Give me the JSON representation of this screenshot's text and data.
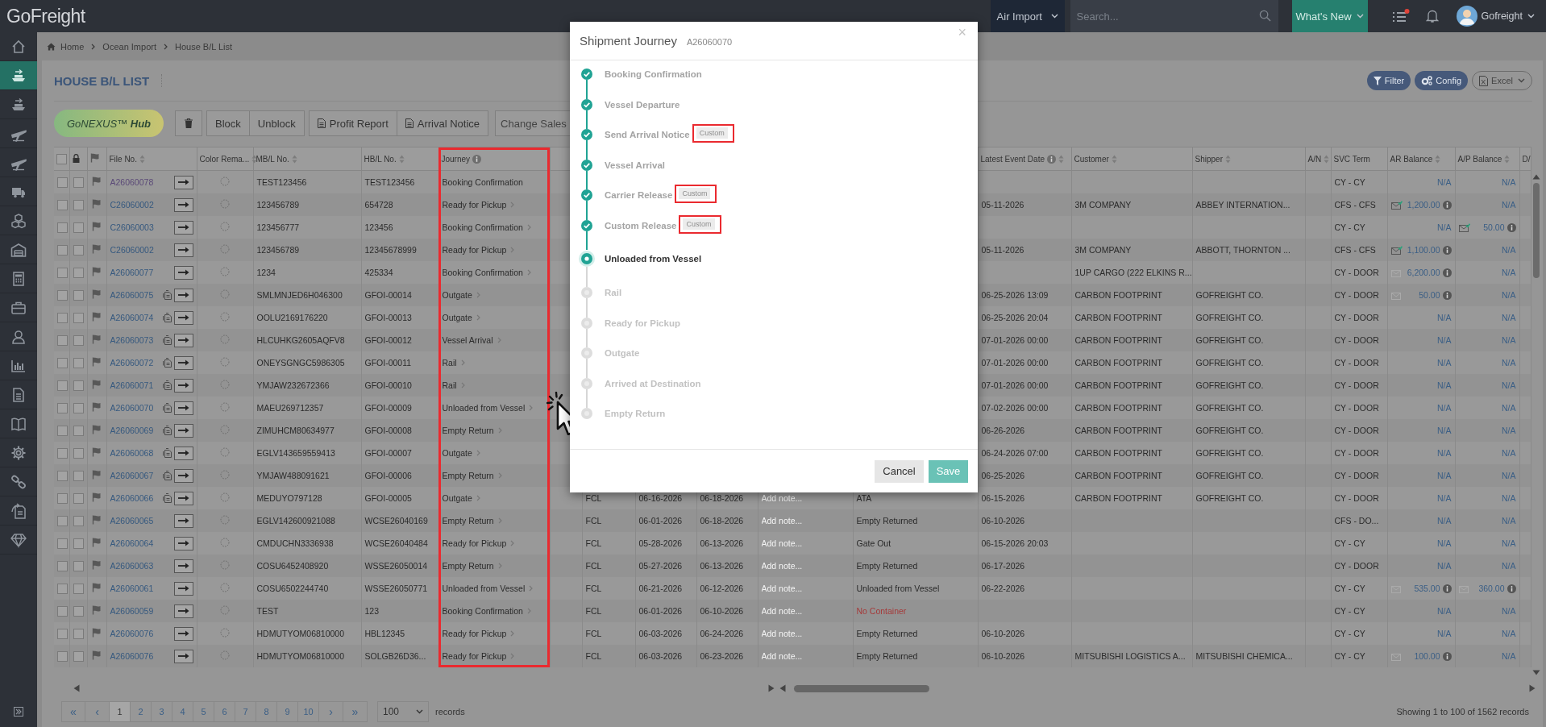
{
  "topbar": {
    "logo": "GoFreight",
    "module": "Air Import",
    "search": {
      "placeholder": "Search..."
    },
    "whats_new": "What's New",
    "has_unread": true,
    "user": "Gofreight"
  },
  "sidebar": {
    "items": [
      {
        "selected": false
      },
      {
        "selected": true
      },
      {
        "selected": false
      },
      {
        "selected": false
      },
      {
        "selected": false
      },
      {
        "selected": false
      },
      {
        "selected": false
      },
      {
        "selected": false
      },
      {
        "selected": false
      },
      {
        "selected": false
      },
      {
        "selected": false
      },
      {
        "selected": false
      },
      {
        "selected": false
      },
      {
        "selected": false
      },
      {
        "selected": false
      },
      {
        "selected": false
      },
      {
        "selected": false
      },
      {
        "selected": false
      }
    ]
  },
  "breadcrumb": [
    "Home",
    "Ocean Import",
    "House B/L List"
  ],
  "page_title": "HOUSE B/L LIST",
  "header_buttons": [
    {
      "kind": "filter",
      "label": "Filter"
    },
    {
      "kind": "config",
      "label": "Config"
    },
    {
      "kind": "excel",
      "label": "Excel"
    }
  ],
  "toolbar": {
    "hub": "GoNEXUS™ **Hub**",
    "buttons": [
      {
        "kind": "delete"
      },
      {
        "kind": "text",
        "label": "Block"
      },
      {
        "kind": "text",
        "label": "Unblock"
      },
      {
        "kind": "report",
        "label": "Profit Report"
      },
      {
        "kind": "report",
        "label": "Arrival Notice"
      }
    ],
    "sales_select": {
      "placeholder": "Change Sales"
    }
  },
  "table": {
    "select_all": false,
    "columns": [
      {
        "kind": "checkbox"
      },
      {
        "kind": "lock"
      },
      {
        "kind": "flag"
      },
      {
        "kind": "text",
        "label": "File No.",
        "sortable": true,
        "info": false,
        "highlighted": false
      },
      {
        "kind": "text",
        "label": "Color Rema...",
        "sortable": true,
        "info": false,
        "highlighted": false
      },
      {
        "kind": "text",
        "label": "MB/L No.",
        "sortable": true,
        "info": false,
        "highlighted": false
      },
      {
        "kind": "text",
        "label": "HB/L No.",
        "sortable": true,
        "info": false,
        "highlighted": false
      },
      {
        "kind": "text",
        "label": "Journey",
        "sortable": false,
        "info": true,
        "highlighted": true
      },
      {
        "kind": "blank"
      },
      {
        "kind": "blank"
      },
      {
        "kind": "blank"
      },
      {
        "kind": "blank"
      },
      {
        "kind": "blank"
      },
      {
        "kind": "blank"
      },
      {
        "kind": "text",
        "label": "Latest Event Date",
        "sortable": true,
        "info": true,
        "highlighted": false
      },
      {
        "kind": "text",
        "label": "Customer",
        "sortable": true,
        "info": false,
        "highlighted": false
      },
      {
        "kind": "text",
        "label": "Shipper",
        "sortable": true,
        "info": false,
        "highlighted": false
      },
      {
        "kind": "text",
        "label": "A/N",
        "sortable": true,
        "info": false,
        "highlighted": false
      },
      {
        "kind": "text",
        "label": "SVC Term",
        "sortable": false,
        "info": false,
        "highlighted": false
      },
      {
        "kind": "text",
        "label": "AR Balance",
        "sortable": true,
        "info": false,
        "highlighted": false
      },
      {
        "kind": "text",
        "label": "A/P Balance",
        "sortable": true,
        "info": false,
        "highlighted": false
      },
      {
        "kind": "text",
        "label": "D/",
        "sortable": false,
        "info": false,
        "highlighted": false
      }
    ],
    "rows": [
      {
        "checked": false,
        "locked": false,
        "file_no": "A26060078",
        "visited": true,
        "doc": false,
        "mbl": "TEST123456",
        "hbl": "TEST123456",
        "journey": "Booking Confirmation",
        "journey_link": false,
        "svc_term": "CY - CY",
        "ar": {
          "amount": "N/A"
        },
        "ap": {
          "amount": "N/A"
        }
      },
      {
        "checked": false,
        "locked": false,
        "file_no": "C26060002",
        "visited": false,
        "doc": false,
        "mbl": "123456789",
        "hbl": "654728",
        "journey": "Ready for Pickup",
        "journey_link": true,
        "latest_event": "05-11-2026",
        "customer": "3M COMPANY",
        "shipper": "ABBEY INTERNATION...",
        "svc_term": "CFS - CFS",
        "ar": {
          "amount": "1,200.00",
          "kind": "sent"
        },
        "ap": {
          "amount": "N/A"
        }
      },
      {
        "checked": false,
        "locked": false,
        "file_no": "C26060003",
        "visited": false,
        "doc": false,
        "mbl": "123456777",
        "hbl": "123456",
        "journey": "Booking Confirmation",
        "journey_link": true,
        "svc_term": "CY - CY",
        "ar": {
          "amount": "N/A"
        },
        "ap": {
          "amount": "50.00",
          "kind": "sent"
        }
      },
      {
        "checked": false,
        "locked": false,
        "file_no": "C26060002",
        "visited": false,
        "doc": false,
        "mbl": "123456789",
        "hbl": "12345678999",
        "journey": "Ready for Pickup",
        "journey_link": true,
        "latest_event": "05-11-2026",
        "customer": "3M COMPANY",
        "shipper": "ABBOTT, THORNTON ...",
        "svc_term": "CFS - CFS",
        "ar": {
          "amount": "1,100.00",
          "kind": "sent"
        },
        "ap": {
          "amount": "N/A"
        }
      },
      {
        "checked": false,
        "locked": false,
        "file_no": "A26060077",
        "visited": false,
        "doc": false,
        "mbl": "1234",
        "hbl": "425334",
        "journey": "Booking Confirmation",
        "journey_link": true,
        "customer": "1UP CARGO (222 ELKINS R...",
        "svc_term": "CY - DOOR",
        "ar": {
          "amount": "6,200.00",
          "kind": "unsent"
        },
        "ap": {
          "amount": "N/A"
        }
      },
      {
        "checked": false,
        "locked": false,
        "file_no": "A26060075",
        "visited": false,
        "doc": true,
        "mbl": "SMLMNJED6H046300",
        "hbl": "GFOI-00014",
        "journey": "Outgate",
        "journey_link": true,
        "latest_event": "06-25-2026 13:09",
        "customer": "CARBON FOOTPRINT",
        "shipper": "GOFREIGHT CO.",
        "svc_term": "CY - DOOR",
        "ar": {
          "amount": "50.00",
          "kind": "unsent"
        },
        "ap": {
          "amount": "N/A"
        }
      },
      {
        "checked": false,
        "locked": false,
        "file_no": "A26060074",
        "visited": false,
        "doc": true,
        "mbl": "OOLU2169176220",
        "hbl": "GFOI-00013",
        "journey": "Outgate",
        "journey_link": true,
        "latest_event": "06-25-2026 20:04",
        "customer": "CARBON FOOTPRINT",
        "shipper": "GOFREIGHT CO.",
        "svc_term": "CY - DOOR",
        "ar": {
          "amount": "N/A"
        },
        "ap": {
          "amount": "N/A"
        }
      },
      {
        "checked": false,
        "locked": false,
        "file_no": "A26060073",
        "visited": false,
        "doc": true,
        "mbl": "HLCUHKG2605AQFV8",
        "hbl": "GFOI-00012",
        "journey": "Vessel Arrival",
        "journey_link": true,
        "latest_event": "07-01-2026 00:00",
        "customer": "CARBON FOOTPRINT",
        "shipper": "GOFREIGHT CO.",
        "svc_term": "CY - DOOR",
        "ar": {
          "amount": "N/A"
        },
        "ap": {
          "amount": "N/A"
        }
      },
      {
        "checked": false,
        "locked": false,
        "file_no": "A26060072",
        "visited": false,
        "doc": true,
        "mbl": "ONEYSGNGC5986305",
        "hbl": "GFOI-00011",
        "journey": "Rail",
        "journey_link": true,
        "latest_event": "07-01-2026 00:00",
        "customer": "CARBON FOOTPRINT",
        "shipper": "GOFREIGHT CO.",
        "svc_term": "CY - DOOR",
        "ar": {
          "amount": "N/A"
        },
        "ap": {
          "amount": "N/A"
        }
      },
      {
        "checked": false,
        "locked": false,
        "file_no": "A26060071",
        "visited": false,
        "doc": true,
        "mbl": "YMJAW232672366",
        "hbl": "GFOI-00010",
        "journey": "Rail",
        "journey_link": true,
        "latest_event": "07-01-2026 00:00",
        "customer": "CARBON FOOTPRINT",
        "shipper": "GOFREIGHT CO.",
        "svc_term": "CY - DOOR",
        "ar": {
          "amount": "N/A"
        },
        "ap": {
          "amount": "N/A"
        }
      },
      {
        "checked": false,
        "locked": false,
        "file_no": "A26060070",
        "visited": false,
        "doc": true,
        "mbl": "MAEU269712357",
        "hbl": "GFOI-00009",
        "journey": "Unloaded from Vessel",
        "journey_link": true,
        "latest_event": "07-02-2026 00:00",
        "customer": "CARBON FOOTPRINT",
        "shipper": "GOFREIGHT CO.",
        "svc_term": "CY - DOOR",
        "ar": {
          "amount": "N/A"
        },
        "ap": {
          "amount": "N/A"
        }
      },
      {
        "checked": false,
        "locked": false,
        "file_no": "A26060069",
        "visited": false,
        "doc": true,
        "mbl": "ZIMUHCM80634977",
        "hbl": "GFOI-00008",
        "journey": "Empty Return",
        "journey_link": true,
        "latest_event": "06-26-2026",
        "customer": "CARBON FOOTPRINT",
        "shipper": "GOFREIGHT CO.",
        "svc_term": "CY - DOOR",
        "ar": {
          "amount": "N/A"
        },
        "ap": {
          "amount": "N/A"
        }
      },
      {
        "checked": false,
        "locked": false,
        "file_no": "A26060068",
        "visited": false,
        "doc": true,
        "mbl": "EGLV143659559413",
        "hbl": "GFOI-00007",
        "journey": "Outgate",
        "journey_link": true,
        "latest_event": "06-24-2026 07:00",
        "customer": "CARBON FOOTPRINT",
        "shipper": "GOFREIGHT CO.",
        "svc_term": "CY - DOOR",
        "ar": {
          "amount": "N/A"
        },
        "ap": {
          "amount": "N/A"
        }
      },
      {
        "checked": false,
        "locked": false,
        "file_no": "A26060067",
        "visited": false,
        "doc": true,
        "mbl": "YMJAW488091621",
        "hbl": "GFOI-00006",
        "journey": "Empty Return",
        "journey_link": true,
        "latest_event": "06-25-2026",
        "customer": "CARBON FOOTPRINT",
        "shipper": "GOFREIGHT CO.",
        "svc_term": "CY - DOOR",
        "ar": {
          "amount": "N/A"
        },
        "ap": {
          "amount": "N/A"
        }
      },
      {
        "checked": false,
        "locked": false,
        "file_no": "A26060066",
        "visited": false,
        "doc": true,
        "mbl": "MEDUYO797128",
        "hbl": "GFOI-00005",
        "journey": "Outgate",
        "journey_link": true,
        "load_type": "FCL",
        "date_1": "06-16-2026",
        "date_2": "06-18-2026",
        "note": {
          "placeholder": "Add note..."
        },
        "last_event": "ATA",
        "last_event_alert": false,
        "latest_event": "06-15-2026",
        "customer": "CARBON FOOTPRINT",
        "shipper": "GOFREIGHT CO.",
        "svc_term": "CY - DOOR",
        "ar": {
          "amount": "N/A"
        },
        "ap": {
          "amount": "N/A"
        }
      },
      {
        "checked": false,
        "locked": false,
        "file_no": "A26060065",
        "visited": false,
        "doc": false,
        "mbl": "EGLV142600921088",
        "hbl": "WCSE26040169",
        "journey": "Empty Return",
        "journey_link": true,
        "load_type": "FCL",
        "date_1": "06-01-2026",
        "date_2": "06-18-2026",
        "note": {
          "placeholder": "Add note..."
        },
        "last_event": "Empty Returned",
        "last_event_alert": false,
        "latest_event": "06-10-2026",
        "svc_term": "CFS - DO...",
        "ar": {
          "amount": "N/A"
        },
        "ap": {
          "amount": "N/A"
        }
      },
      {
        "checked": false,
        "locked": false,
        "file_no": "A26060064",
        "visited": false,
        "doc": false,
        "mbl": "CMDUCHN3336938",
        "hbl": "WCSE26040484",
        "journey": "Ready for Pickup",
        "journey_link": true,
        "load_type": "FCL",
        "date_1": "05-28-2026",
        "date_2": "06-13-2026",
        "note": {
          "placeholder": "Add note..."
        },
        "last_event": "Gate Out",
        "last_event_alert": false,
        "latest_event": "06-15-2026 20:03",
        "svc_term": "CY - CY",
        "ar": {
          "amount": "N/A"
        },
        "ap": {
          "amount": "N/A"
        }
      },
      {
        "checked": false,
        "locked": false,
        "file_no": "A26060063",
        "visited": false,
        "doc": false,
        "mbl": "COSU6452408920",
        "hbl": "WSSE26050014",
        "journey": "Empty Return",
        "journey_link": true,
        "load_type": "FCL",
        "date_1": "05-27-2026",
        "date_2": "06-13-2026",
        "note": {
          "placeholder": "Add note..."
        },
        "last_event": "Empty Returned",
        "last_event_alert": false,
        "latest_event": "06-17-2026",
        "svc_term": "CY - DOOR",
        "ar": {
          "amount": "N/A"
        },
        "ap": {
          "amount": "N/A"
        }
      },
      {
        "checked": false,
        "locked": false,
        "file_no": "A26060061",
        "visited": false,
        "doc": false,
        "mbl": "COSU6502244740",
        "hbl": "WSSE26050771",
        "journey": "Unloaded from Vessel",
        "journey_link": true,
        "load_type": "FCL",
        "date_1": "06-21-2026",
        "date_2": "06-12-2026",
        "note": {
          "placeholder": "Add note..."
        },
        "last_event": "Unloaded from Vessel",
        "last_event_alert": false,
        "latest_event": "06-22-2026",
        "svc_term": "CY - CY",
        "ar": {
          "amount": "535.00",
          "kind": "unsent"
        },
        "ap": {
          "amount": "360.00",
          "kind": "unsent"
        }
      },
      {
        "checked": false,
        "locked": false,
        "file_no": "A26060059",
        "visited": false,
        "doc": false,
        "mbl": "TEST",
        "hbl": "123",
        "journey": "Booking Confirmation",
        "journey_link": true,
        "load_type": "FCL",
        "date_1": "06-01-2026",
        "date_2": "06-10-2026",
        "note": {
          "placeholder": "Add note..."
        },
        "last_event": "No Container",
        "last_event_alert": true,
        "svc_term": "CY - CY",
        "ar": {
          "amount": "N/A"
        },
        "ap": {
          "amount": "N/A"
        }
      },
      {
        "checked": false,
        "locked": false,
        "file_no": "A26060076",
        "visited": false,
        "doc": false,
        "mbl": "HDMUTYOM06810000",
        "hbl": "HBL12345",
        "journey": "Ready for Pickup",
        "journey_link": true,
        "load_type": "FCL",
        "date_1": "06-03-2026",
        "date_2": "06-24-2026",
        "note": {
          "placeholder": "Add note..."
        },
        "last_event": "Empty Returned",
        "last_event_alert": false,
        "latest_event": "06-10-2026",
        "svc_term": "CY - CY",
        "ar": {
          "amount": "N/A"
        },
        "ap": {
          "amount": "N/A"
        }
      },
      {
        "checked": false,
        "locked": false,
        "file_no": "A26060076",
        "visited": false,
        "doc": false,
        "mbl": "HDMUTYOM06810000",
        "hbl": "SOLGB26D36...",
        "journey": "Ready for Pickup",
        "journey_link": true,
        "load_type": "FCL",
        "date_1": "06-03-2026",
        "date_2": "06-23-2026",
        "note": {
          "placeholder": "Add note..."
        },
        "last_event": "Empty Returned",
        "last_event_alert": false,
        "latest_event": "06-10-2026",
        "customer": "MITSUBISHI LOGISTICS A...",
        "shipper": "MITSUBISHI CHEMICA...",
        "svc_term": "CY - CY",
        "ar": {
          "amount": "100.00",
          "kind": "unsent"
        },
        "ap": {
          "amount": "N/A"
        }
      }
    ]
  },
  "pagination": {
    "first": "«",
    "prev": "‹",
    "pages": [
      {
        "label": "1",
        "selected": true
      },
      {
        "label": "2",
        "selected": false
      },
      {
        "label": "3",
        "selected": false
      },
      {
        "label": "4",
        "selected": false
      },
      {
        "label": "5",
        "selected": false
      },
      {
        "label": "6",
        "selected": false
      },
      {
        "label": "7",
        "selected": false
      },
      {
        "label": "8",
        "selected": false
      },
      {
        "label": "9",
        "selected": false
      },
      {
        "label": "10",
        "selected": false
      }
    ],
    "next": "›",
    "last": "»",
    "page_size": "100",
    "records_label": "records",
    "summary": "Showing 1 to 100 of 1562 records"
  },
  "modal": {
    "title": "Shipment Journey",
    "file_no": "A26060070",
    "close": "×",
    "steps": [
      {
        "label": "Booking Confirmation",
        "kind": "done"
      },
      {
        "label": "Vessel Departure",
        "kind": "done"
      },
      {
        "label": "Send Arrival Notice",
        "kind": "done",
        "tag": "Custom",
        "tag_highlighted": true
      },
      {
        "label": "Vessel Arrival",
        "kind": "done"
      },
      {
        "label": "Carrier Release",
        "kind": "done",
        "tag": "Custom",
        "tag_highlighted": true
      },
      {
        "label": "Custom Release",
        "kind": "done",
        "tag": "Custom",
        "tag_highlighted": true
      },
      {
        "label": "Unloaded from Vessel",
        "kind": "current"
      },
      {
        "label": "Rail",
        "kind": "pending"
      },
      {
        "label": "Ready for Pickup",
        "kind": "pending"
      },
      {
        "label": "Outgate",
        "kind": "pending"
      },
      {
        "label": "Arrived at Destination",
        "kind": "pending"
      },
      {
        "label": "Empty Return",
        "kind": "pending"
      }
    ],
    "cancel": "Cancel",
    "save": "Save"
  }
}
